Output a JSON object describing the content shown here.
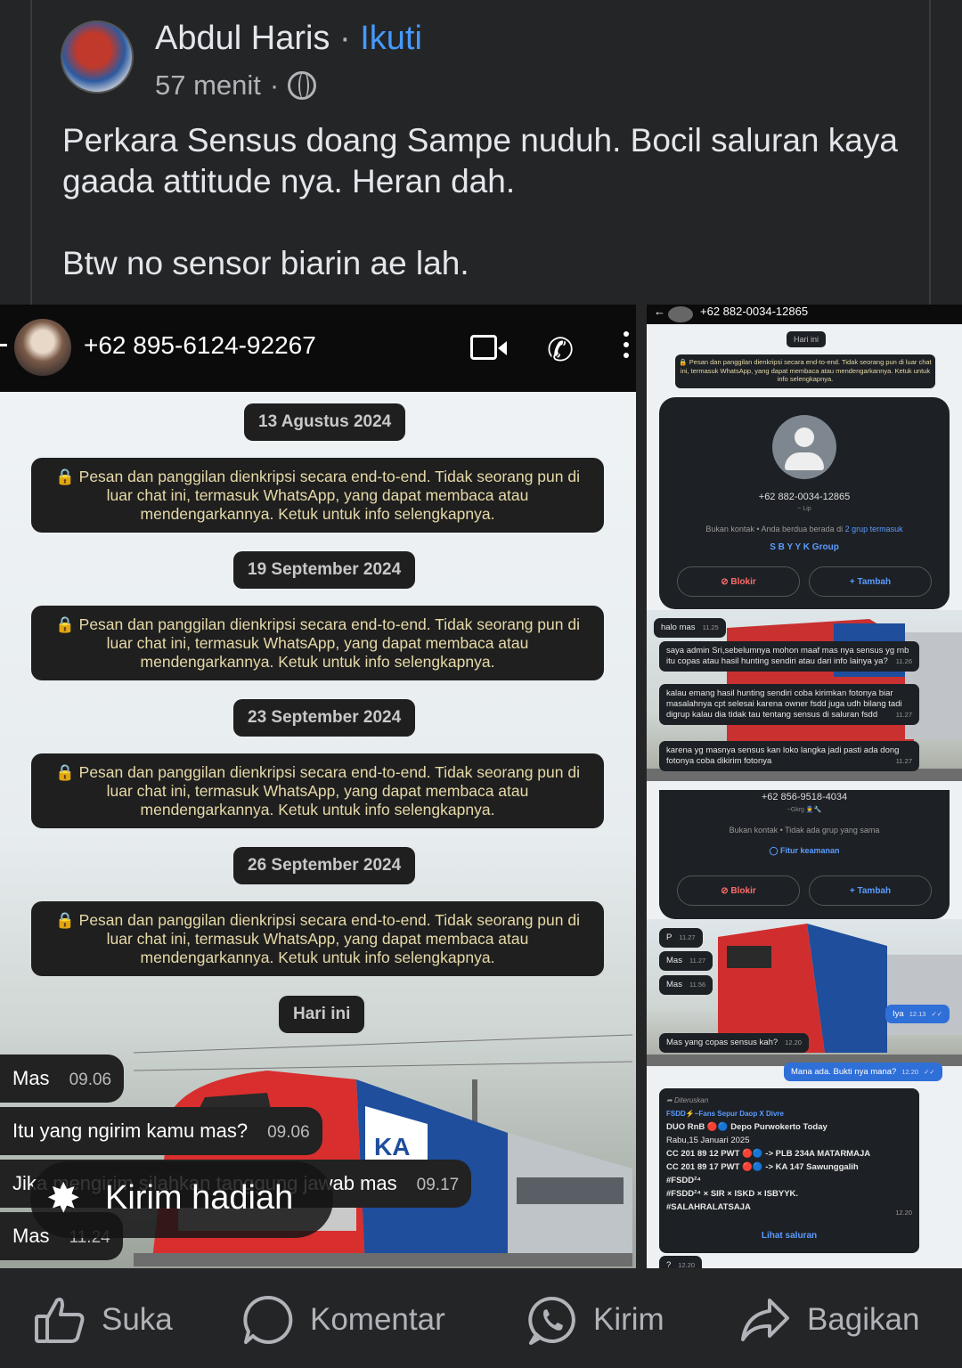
{
  "post": {
    "author": "Abdul Haris",
    "separator": "·",
    "follow_label": "Ikuti",
    "time": "57 menit",
    "meta_dot": "·",
    "paragraphs": [
      "Perkara Sensus doang Sampe nuduh. Bocil saluran kaya gaada attitude nya. Heran dah.",
      "Btw no sensor biarin ae lah."
    ]
  },
  "left_shot": {
    "contact": "+62 895-6124-92267",
    "date_pills": [
      "13 Agustus 2024",
      "19 September 2024",
      "23 September 2024",
      "26 September 2024",
      "Hari ini"
    ],
    "e2e_notice": "🔒 Pesan dan panggilan dienkripsi secara end-to-end. Tidak seorang pun di luar chat ini, termasuk WhatsApp, yang dapat membaca atau mendengarkannya. Ketuk untuk info selengkapnya.",
    "messages": [
      {
        "text": "Mas",
        "time": "09.06"
      },
      {
        "text": "Itu yang ngirim kamu mas?",
        "time": "09.06"
      },
      {
        "text": "Jika mengirim silahkan tanggung jawab mas",
        "time": "09.17"
      },
      {
        "text": "Mas",
        "time": "11.24"
      }
    ],
    "gift_label": "Kirim hadiah"
  },
  "right_shot": {
    "contact": "+62 882-0034-12865",
    "today_pill": "Hari ini",
    "e2e_notice": "🔒 Pesan dan panggilan dienkripsi secara end-to-end. Tidak seorang pun di luar chat ini, termasuk WhatsApp, yang dapat membaca atau mendengarkannya. Ketuk untuk info selengkapnya.",
    "card1": {
      "number": "+62 882-0034-12865",
      "sub": "~ Lip",
      "info_prefix": "Bukan kontak • Anda berdua berada di",
      "info_link": "2 grup termasuk",
      "group": "S B Y Y K Group",
      "block": "Blokir",
      "add": "Tambah"
    },
    "bubbles1": [
      {
        "text": "halo mas",
        "time": "11.25"
      },
      {
        "text": "saya admin Sri,sebelumnya mohon maaf mas nya sensus yg rnb itu copas atau hasil hunting sendiri atau dari info lainya ya?",
        "time": "11.26"
      },
      {
        "text": "kalau emang hasil hunting sendiri coba kirimkan fotonya biar masalahnya cpt selesai karena owner fsdd juga udh bilang tadi digrup kalau dia tidak tau tentang sensus di saluran fsdd",
        "time": "11.27"
      },
      {
        "text": "karena yg masnya sensus kan loko langka jadi pasti ada dong fotonya coba dikirim fotonya",
        "time": "11.27"
      }
    ],
    "card2": {
      "number": "+62 856-9518-4034",
      "sub": "~Gkrg 👮🔧",
      "info": "Bukan kontak • Tidak ada grup yang sama",
      "security": "Fitur keamanan",
      "block": "Blokir",
      "add": "Tambah"
    },
    "bubbles2": [
      {
        "text": "P",
        "time": "11.27"
      },
      {
        "text": "Mas",
        "time": "11.27"
      },
      {
        "text": "Mas",
        "time": "11.56"
      }
    ],
    "out1": {
      "text": "Iya",
      "time": "12.13"
    },
    "in_copas": {
      "text": "Mas yang copas sensus kah?",
      "time": "12.20"
    },
    "out2": {
      "text": "Mana ada. Bukti nya mana?",
      "time": "12.20"
    },
    "forward": {
      "label": "Diteruskan",
      "channel": "FSDD⚡~Fans Sepur Daop X Divre",
      "lines": [
        "DUO RnB 🔴🔵 Depo Purwokerto Today",
        "Rabu,15 Januari 2025",
        "CC 201 89 12 PWT 🔴🔵 -> PLB 234A MATARMAJA",
        "CC 201 89 17 PWT 🔴🔵 -> KA 147 Sawunggalih",
        "#FSDD²⁴",
        "#FSDD²⁴ × SIR × ISKD × ISBYYK.",
        "#SALAHRALATSAJA"
      ],
      "time": "12.20",
      "view": "Lihat saluran"
    },
    "last": {
      "text": "?",
      "time": "12.20"
    }
  },
  "actions": [
    {
      "label": "Suka",
      "icon": "like-icon"
    },
    {
      "label": "Komentar",
      "icon": "comment-icon"
    },
    {
      "label": "Kirim",
      "icon": "whatsapp-icon"
    },
    {
      "label": "Bagikan",
      "icon": "share-icon"
    }
  ],
  "colors": {
    "background": "#242526",
    "text": "#e4e6eb",
    "muted": "#b0b3b8",
    "follow": "#4599ff",
    "bubble_out": "#2f6fd8"
  }
}
